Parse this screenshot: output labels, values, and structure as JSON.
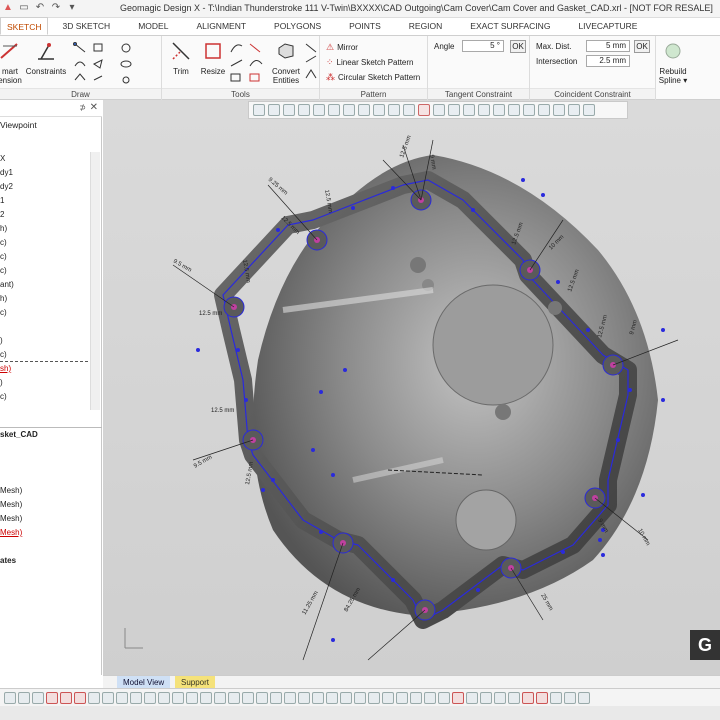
{
  "window": {
    "title": "Geomagic Design X - T:\\Indian Thunderstroke 111 V-Twin\\BXXXX\\CAD Outgoing\\Cam Cover\\Cam Cover and Gasket_CAD.xrl - [NOT FOR RESALE]"
  },
  "tabs": [
    "SKETCH",
    "3D SKETCH",
    "MODEL",
    "ALIGNMENT",
    "POLYGONS",
    "POINTS",
    "REGION",
    "EXACT SURFACING",
    "LIVECAPTURE"
  ],
  "ribbon": {
    "draw": {
      "label": "Draw",
      "smart_dimension": "mart\nension",
      "constraints": "Constraints"
    },
    "tools": {
      "label": "Tools",
      "trim": "Trim",
      "resize": "Resize",
      "convert_entities": "Convert\nEntities"
    },
    "pattern": {
      "label": "Pattern",
      "mirror": "Mirror",
      "linear": "Linear Sketch Pattern",
      "circular": "Circular Sketch Pattern"
    },
    "tangent": {
      "label": "Tangent Constraint",
      "angle_label": "Angle",
      "angle_value": "5 °",
      "ok": "OK"
    },
    "coincident": {
      "label": "Coincident Constraint",
      "maxdist_label": "Max. Dist.",
      "maxdist_value": "5 mm",
      "intersection_label": "Intersection",
      "intersection_value": "2.5 mm",
      "ok": "OK"
    },
    "rebuild": {
      "label": "Rebuild\nSpline ▾"
    }
  },
  "left_panel": {
    "viewpoint": "Viewpoint",
    "pin": "⊅",
    "close": "✕",
    "tree": [
      {
        "text": "X",
        "style": ""
      },
      {
        "text": "dy1",
        "style": ""
      },
      {
        "text": "dy2",
        "style": ""
      },
      {
        "text": "1",
        "style": ""
      },
      {
        "text": "2",
        "style": ""
      },
      {
        "text": "h)",
        "style": ""
      },
      {
        "text": "c)",
        "style": ""
      },
      {
        "text": "c)",
        "style": ""
      },
      {
        "text": "c)",
        "style": ""
      },
      {
        "text": "ant)",
        "style": ""
      },
      {
        "text": "h)",
        "style": ""
      },
      {
        "text": "c)",
        "style": ""
      },
      {
        "text": ")",
        "style": ""
      },
      {
        "text": "c)",
        "style": ""
      },
      {
        "text": "sh)",
        "style": "red"
      },
      {
        "text": ")",
        "style": ""
      },
      {
        "text": "c)",
        "style": ""
      }
    ],
    "lower": [
      {
        "text": "sket_CAD",
        "style": "bold"
      },
      {
        "text": "Mesh)",
        "style": ""
      },
      {
        "text": "Mesh)",
        "style": ""
      },
      {
        "text": "Mesh)",
        "style": ""
      },
      {
        "text": "Mesh)",
        "style": "red"
      },
      {
        "text": "ates",
        "style": "bold"
      }
    ]
  },
  "bottom_tabs": {
    "model_view": "Model View",
    "support": "Support"
  },
  "dimensions": [
    "12.5 mm",
    "9 mm",
    "9.25 mm",
    "12.5 mm",
    "12.5 mm",
    "10 mm",
    "12.5 mm",
    "9.5 mm",
    "12.5 mm",
    "12.5 mm",
    "9.5 mm",
    "12.5 mm",
    "12.5 mm",
    "11.25 mm",
    "84.25 mm",
    "10 mm",
    "9 mm",
    "25 mm",
    "12.5 mm",
    "9 mm",
    "12.5 mm"
  ],
  "logo": "G"
}
